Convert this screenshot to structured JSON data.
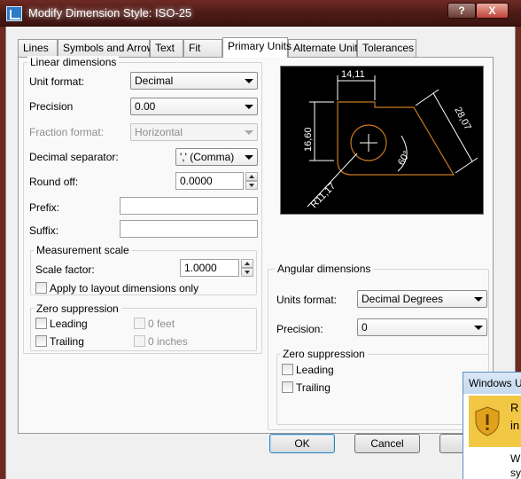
{
  "window": {
    "title": "Modify Dimension Style: ISO-25",
    "help_label": "?",
    "close_label": "X"
  },
  "tabs": [
    "Lines",
    "Symbols and Arrows",
    "Text",
    "Fit",
    "Primary Units",
    "Alternate Units",
    "Tolerances"
  ],
  "active_tab": "Primary Units",
  "linear": {
    "group_title": "Linear dimensions",
    "unit_format_label": "Unit format:",
    "unit_format_value": "Decimal",
    "precision_label": "Precision",
    "precision_value": "0.00",
    "fraction_format_label": "Fraction format:",
    "fraction_format_value": "Horizontal",
    "decimal_separator_label": "Decimal separator:",
    "decimal_separator_value": "',' (Comma)",
    "round_off_label": "Round off:",
    "round_off_value": "0.0000",
    "prefix_label": "Prefix:",
    "prefix_value": "",
    "suffix_label": "Suffix:",
    "suffix_value": ""
  },
  "measurement_scale": {
    "group_title": "Measurement scale",
    "scale_factor_label": "Scale factor:",
    "scale_factor_value": "1.0000",
    "apply_layout_label": "Apply to layout dimensions only"
  },
  "zero_suppression_linear": {
    "group_title": "Zero suppression",
    "leading_label": "Leading",
    "trailing_label": "Trailing",
    "feet_label": "0 feet",
    "inches_label": "0 inches"
  },
  "angular": {
    "group_title": "Angular dimensions",
    "units_format_label": "Units format:",
    "units_format_value": "Decimal Degrees",
    "precision_label": "Precision:",
    "precision_value": "0",
    "zero_title": "Zero suppression",
    "leading_label": "Leading",
    "trailing_label": "Trailing"
  },
  "preview": {
    "dim_top": "14,11",
    "dim_left": "16,60",
    "dim_right": "28,07",
    "dim_angle": "60°",
    "dim_radius": "R11,17"
  },
  "buttons": {
    "ok": "OK",
    "cancel": "Cancel"
  },
  "popup": {
    "title": "Windows U",
    "line1": "R",
    "line2": "in",
    "line3": "W",
    "line4": "sy"
  },
  "colors": {
    "preview_bg": "#000000",
    "preview_line": "#ffffff",
    "preview_shape": "#c8781e"
  }
}
